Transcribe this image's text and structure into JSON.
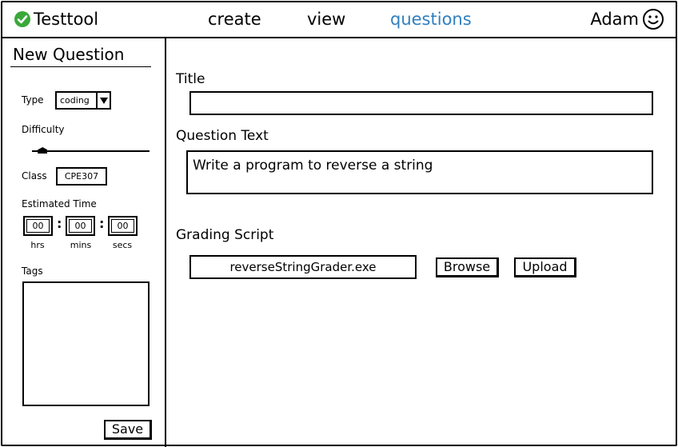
{
  "app": {
    "name": "Testtool"
  },
  "nav": {
    "create": "create",
    "view": "view",
    "questions": "questions"
  },
  "user": {
    "name": "Adam"
  },
  "sidebar": {
    "title": "New Question",
    "type_label": "Type",
    "type_value": "coding",
    "difficulty_label": "Difficulty",
    "difficulty_level": 0.09,
    "class_label": "Class",
    "class_value": "CPE307",
    "time_label": "Estimated Time",
    "hours": "00",
    "minutes": "00",
    "seconds": "00",
    "hours_unit": "hrs",
    "minutes_unit": "mins",
    "seconds_unit": "secs",
    "tags_label": "Tags",
    "save_label": "Save"
  },
  "main": {
    "title_label": "Title",
    "title_value": "",
    "question_label": "Question Text",
    "question_value": "Write a program to reverse a string",
    "grading_label": "Grading Script",
    "grading_file": "reverseStringGrader.exe",
    "browse_label": "Browse",
    "upload_label": "Upload"
  },
  "colors": {
    "active_nav": "#2f7fc0",
    "check": "#3aa83a"
  }
}
